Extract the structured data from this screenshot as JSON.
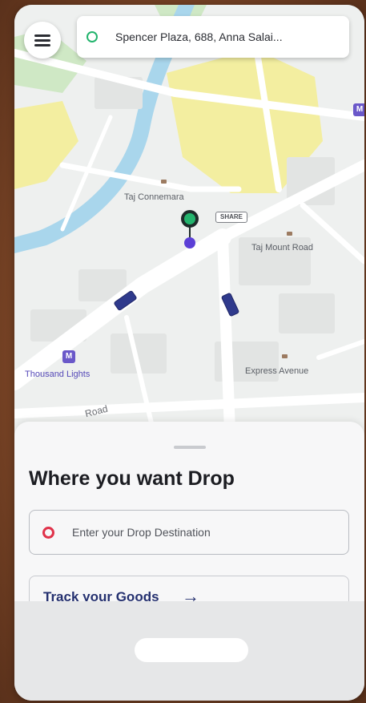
{
  "map": {
    "pickup_address": "Spencer Plaza, 688, Anna Salai...",
    "pickup_icon": "green-ring-pin-icon",
    "menu_icon": "hamburger-menu-icon",
    "pin_tag": "SHARE",
    "places": [
      {
        "name": "Taj Connemara"
      },
      {
        "name": "Taj Mount Road"
      },
      {
        "name": "Express Avenue"
      }
    ],
    "metro_stations": [
      {
        "name": "Thousand Lights"
      }
    ],
    "road_name": "Road",
    "colors": {
      "river": "#a9d6ec",
      "park": "#f3eea0",
      "green_area": "#cfe8c5",
      "pickup_green": "#23b46d",
      "drop_purple": "#5b3fd6",
      "metro": "#6a58c9"
    }
  },
  "sheet": {
    "title": "Where you want Drop",
    "drop_placeholder": "Enter your Drop Destination",
    "drop_icon": "red-ring-pin-icon",
    "track_label": "Track your Goods",
    "track_arrow": "→"
  }
}
